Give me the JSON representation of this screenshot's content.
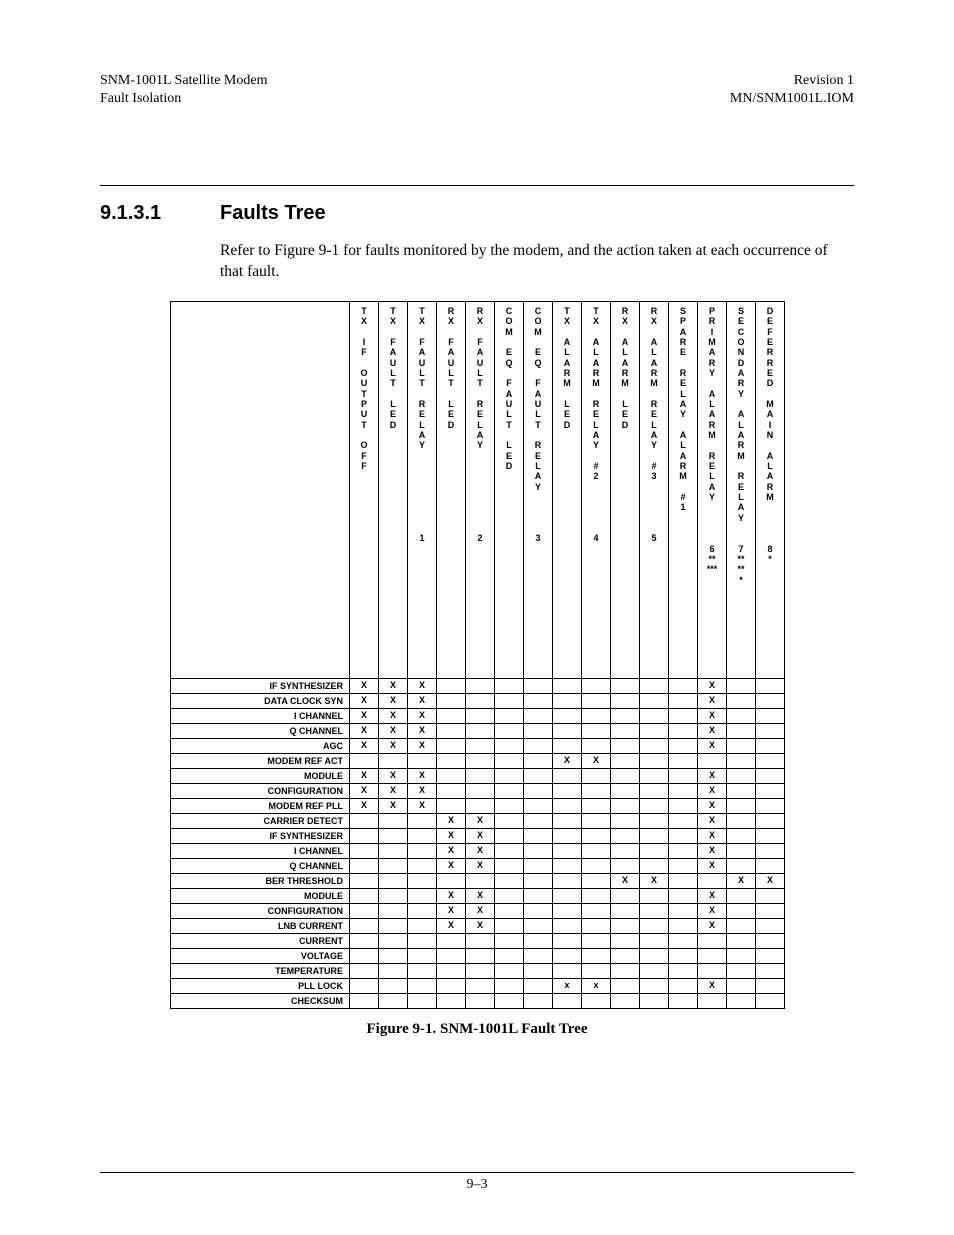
{
  "header": {
    "left1": "SNM-1001L Satellite Modem",
    "left2": "Fault Isolation",
    "right1": "Revision 1",
    "right2": "MN/SNM1001L.IOM"
  },
  "section": {
    "number": "9.1.3.1",
    "title": "Faults Tree",
    "intro": "Refer to Figure 9-1 for faults monitored by the modem, and the action taken at each occurrence of that fault."
  },
  "columns": [
    {
      "lines": [
        "T",
        "X",
        " ",
        "I",
        "F",
        " ",
        "O",
        "U",
        "T",
        "P",
        "U",
        "T",
        " ",
        "O",
        "F",
        "F"
      ]
    },
    {
      "lines": [
        "T",
        "X",
        " ",
        "F",
        "A",
        "U",
        "L",
        "T",
        " ",
        "L",
        "E",
        "D"
      ]
    },
    {
      "lines": [
        "T",
        "X",
        " ",
        "F",
        "A",
        "U",
        "L",
        "T",
        " ",
        "R",
        "E",
        "L",
        "A",
        "Y",
        " ",
        " ",
        " ",
        " ",
        " ",
        " ",
        " ",
        " ",
        "1"
      ]
    },
    {
      "lines": [
        "R",
        "X",
        " ",
        "F",
        "A",
        "U",
        "L",
        "T",
        " ",
        "L",
        "E",
        "D"
      ]
    },
    {
      "lines": [
        "R",
        "X",
        " ",
        "F",
        "A",
        "U",
        "L",
        "T",
        " ",
        "R",
        "E",
        "L",
        "A",
        "Y",
        " ",
        " ",
        " ",
        " ",
        " ",
        " ",
        " ",
        " ",
        "2"
      ]
    },
    {
      "lines": [
        "C",
        "O",
        "M",
        " ",
        "E",
        "Q",
        " ",
        "F",
        "A",
        "U",
        "L",
        "T",
        " ",
        "L",
        "E",
        "D"
      ]
    },
    {
      "lines": [
        "C",
        "O",
        "M",
        " ",
        "E",
        "Q",
        " ",
        "F",
        "A",
        "U",
        "L",
        "T",
        " ",
        "R",
        "E",
        "L",
        "A",
        "Y",
        " ",
        " ",
        " ",
        " ",
        "3"
      ]
    },
    {
      "lines": [
        "T",
        "X",
        " ",
        "A",
        "L",
        "A",
        "R",
        "M",
        " ",
        "L",
        "E",
        "D"
      ]
    },
    {
      "lines": [
        "T",
        "X",
        " ",
        "A",
        "L",
        "A",
        "R",
        "M",
        " ",
        "R",
        "E",
        "L",
        "A",
        "Y",
        " ",
        "#",
        "2",
        " ",
        " ",
        " ",
        " ",
        " ",
        "4"
      ]
    },
    {
      "lines": [
        "R",
        "X",
        " ",
        "A",
        "L",
        "A",
        "R",
        "M",
        " ",
        "L",
        "E",
        "D"
      ]
    },
    {
      "lines": [
        "R",
        "X",
        " ",
        "A",
        "L",
        "A",
        "R",
        "M",
        " ",
        "R",
        "E",
        "L",
        "A",
        "Y",
        " ",
        "#",
        "3",
        " ",
        " ",
        " ",
        " ",
        " ",
        "5"
      ]
    },
    {
      "lines": [
        "S",
        "P",
        "A",
        "R",
        "E",
        " ",
        "R",
        "E",
        "L",
        "A",
        "Y",
        " ",
        "A",
        "L",
        "A",
        "R",
        "M",
        " ",
        "#",
        "1"
      ]
    },
    {
      "lines": [
        "P",
        "R",
        "I",
        "M",
        "A",
        "R",
        "Y",
        " ",
        "A",
        "L",
        "A",
        "R",
        "M",
        " ",
        "R",
        "E",
        "L",
        "A",
        "Y",
        " ",
        " ",
        " ",
        " ",
        "6",
        "**",
        "***"
      ]
    },
    {
      "lines": [
        "S",
        "E",
        "C",
        "O",
        "N",
        "D",
        "A",
        "R",
        "Y",
        " ",
        "A",
        "L",
        "A",
        "R",
        "M",
        " ",
        "R",
        "E",
        "L",
        "A",
        "Y",
        " ",
        " ",
        "7",
        "**",
        "**",
        "*"
      ]
    },
    {
      "lines": [
        "D",
        "E",
        "F",
        "E",
        "R",
        "R",
        "E",
        "D",
        " ",
        "M",
        "A",
        "I",
        "N",
        " ",
        "A",
        "L",
        "A",
        "R",
        "M",
        " ",
        " ",
        " ",
        " ",
        "8",
        "*"
      ]
    }
  ],
  "rows": [
    {
      "label": "IF SYNTHESIZER",
      "cells": [
        "X",
        "X",
        "X",
        "",
        "",
        "",
        "",
        "",
        "",
        "",
        "",
        "",
        "X",
        "",
        ""
      ]
    },
    {
      "label": "DATA CLOCK SYN",
      "cells": [
        "X",
        "X",
        "X",
        "",
        "",
        "",
        "",
        "",
        "",
        "",
        "",
        "",
        "X",
        "",
        ""
      ]
    },
    {
      "label": "I CHANNEL",
      "cells": [
        "X",
        "X",
        "X",
        "",
        "",
        "",
        "",
        "",
        "",
        "",
        "",
        "",
        "X",
        "",
        ""
      ]
    },
    {
      "label": "Q CHANNEL",
      "cells": [
        "X",
        "X",
        "X",
        "",
        "",
        "",
        "",
        "",
        "",
        "",
        "",
        "",
        "X",
        "",
        ""
      ]
    },
    {
      "label": "AGC",
      "cells": [
        "X",
        "X",
        "X",
        "",
        "",
        "",
        "",
        "",
        "",
        "",
        "",
        "",
        "X",
        "",
        ""
      ]
    },
    {
      "label": "MODEM REF ACT",
      "cells": [
        "",
        "",
        "",
        "",
        "",
        "",
        "",
        "X",
        "X",
        "",
        "",
        "",
        "",
        "",
        ""
      ]
    },
    {
      "label": "MODULE",
      "cells": [
        "X",
        "X",
        "X",
        "",
        "",
        "",
        "",
        "",
        "",
        "",
        "",
        "",
        "X",
        "",
        ""
      ]
    },
    {
      "label": "CONFIGURATION",
      "cells": [
        "X",
        "X",
        "X",
        "",
        "",
        "",
        "",
        "",
        "",
        "",
        "",
        "",
        "X",
        "",
        ""
      ]
    },
    {
      "label": "MODEM REF PLL",
      "cells": [
        "X",
        "X",
        "X",
        "",
        "",
        "",
        "",
        "",
        "",
        "",
        "",
        "",
        "X",
        "",
        ""
      ]
    },
    {
      "label": "CARRIER DETECT",
      "cells": [
        "",
        "",
        "",
        "X",
        "X",
        "",
        "",
        "",
        "",
        "",
        "",
        "",
        "X",
        "",
        ""
      ]
    },
    {
      "label": "IF SYNTHESIZER",
      "cells": [
        "",
        "",
        "",
        "X",
        "X",
        "",
        "",
        "",
        "",
        "",
        "",
        "",
        "X",
        "",
        ""
      ]
    },
    {
      "label": "I CHANNEL",
      "cells": [
        "",
        "",
        "",
        "X",
        "X",
        "",
        "",
        "",
        "",
        "",
        "",
        "",
        "X",
        "",
        ""
      ]
    },
    {
      "label": "Q CHANNEL",
      "cells": [
        "",
        "",
        "",
        "X",
        "X",
        "",
        "",
        "",
        "",
        "",
        "",
        "",
        "X",
        "",
        ""
      ]
    },
    {
      "label": "BER THRESHOLD",
      "cells": [
        "",
        "",
        "",
        "",
        "",
        "",
        "",
        "",
        "",
        "X",
        "X",
        "",
        "",
        "X",
        "X"
      ]
    },
    {
      "label": "MODULE",
      "cells": [
        "",
        "",
        "",
        "X",
        "X",
        "",
        "",
        "",
        "",
        "",
        "",
        "",
        "X",
        "",
        ""
      ]
    },
    {
      "label": "CONFIGURATION",
      "cells": [
        "",
        "",
        "",
        "X",
        "X",
        "",
        "",
        "",
        "",
        "",
        "",
        "",
        "X",
        "",
        ""
      ]
    },
    {
      "label": "LNB CURRENT",
      "cells": [
        "",
        "",
        "",
        "X",
        "X",
        "",
        "",
        "",
        "",
        "",
        "",
        "",
        "X",
        "",
        ""
      ]
    },
    {
      "label": "CURRENT",
      "cells": [
        "",
        "",
        "",
        "",
        "",
        "",
        "",
        "",
        "",
        "",
        "",
        "",
        "",
        "",
        ""
      ]
    },
    {
      "label": "VOLTAGE",
      "cells": [
        "",
        "",
        "",
        "",
        "",
        "",
        "",
        "",
        "",
        "",
        "",
        "",
        "",
        "",
        ""
      ]
    },
    {
      "label": "TEMPERATURE",
      "cells": [
        "",
        "",
        "",
        "",
        "",
        "",
        "",
        "",
        "",
        "",
        "",
        "",
        "",
        "",
        ""
      ]
    },
    {
      "label": "PLL LOCK",
      "cells": [
        "",
        "",
        "",
        "",
        "",
        "",
        "",
        "x",
        "x",
        "",
        "",
        "",
        "X",
        "",
        ""
      ]
    },
    {
      "label": "CHECKSUM",
      "cells": [
        "",
        "",
        "",
        "",
        "",
        "",
        "",
        "",
        "",
        "",
        "",
        "",
        "",
        "",
        ""
      ]
    }
  ],
  "figcap": "Figure 9-1.  SNM-1001L  Fault Tree",
  "pagenum": "9–3",
  "chart_data": {
    "type": "table",
    "title": "SNM-1001L Fault Tree",
    "column_headers": [
      "TX IF OUTPUT OFF",
      "TX FAULT LED",
      "TX FAULT RELAY 1",
      "RX FAULT LED",
      "RX FAULT RELAY 2",
      "COM EQ FAULT LED",
      "COM EQ FAULT RELAY 3",
      "TX ALARM LED",
      "TX ALARM RELAY #2 4",
      "RX ALARM LED",
      "RX ALARM RELAY #3 5",
      "SPARE RELAY ALARM #1",
      "PRIMARY ALARM RELAY 6",
      "SECONDARY ALARM RELAY 7",
      "DEFERRED MAIN ALARM 8"
    ],
    "row_labels": [
      "IF SYNTHESIZER",
      "DATA CLOCK SYN",
      "I CHANNEL",
      "Q CHANNEL",
      "AGC",
      "MODEM REF ACT",
      "MODULE",
      "CONFIGURATION",
      "MODEM REF PLL",
      "CARRIER DETECT",
      "IF SYNTHESIZER",
      "I CHANNEL",
      "Q CHANNEL",
      "BER THRESHOLD",
      "MODULE",
      "CONFIGURATION",
      "LNB CURRENT",
      "CURRENT",
      "VOLTAGE",
      "TEMPERATURE",
      "PLL LOCK",
      "CHECKSUM"
    ],
    "matrix": [
      [
        1,
        1,
        1,
        0,
        0,
        0,
        0,
        0,
        0,
        0,
        0,
        0,
        1,
        0,
        0
      ],
      [
        1,
        1,
        1,
        0,
        0,
        0,
        0,
        0,
        0,
        0,
        0,
        0,
        1,
        0,
        0
      ],
      [
        1,
        1,
        1,
        0,
        0,
        0,
        0,
        0,
        0,
        0,
        0,
        0,
        1,
        0,
        0
      ],
      [
        1,
        1,
        1,
        0,
        0,
        0,
        0,
        0,
        0,
        0,
        0,
        0,
        1,
        0,
        0
      ],
      [
        1,
        1,
        1,
        0,
        0,
        0,
        0,
        0,
        0,
        0,
        0,
        0,
        1,
        0,
        0
      ],
      [
        0,
        0,
        0,
        0,
        0,
        0,
        0,
        1,
        1,
        0,
        0,
        0,
        0,
        0,
        0
      ],
      [
        1,
        1,
        1,
        0,
        0,
        0,
        0,
        0,
        0,
        0,
        0,
        0,
        1,
        0,
        0
      ],
      [
        1,
        1,
        1,
        0,
        0,
        0,
        0,
        0,
        0,
        0,
        0,
        0,
        1,
        0,
        0
      ],
      [
        1,
        1,
        1,
        0,
        0,
        0,
        0,
        0,
        0,
        0,
        0,
        0,
        1,
        0,
        0
      ],
      [
        0,
        0,
        0,
        1,
        1,
        0,
        0,
        0,
        0,
        0,
        0,
        0,
        1,
        0,
        0
      ],
      [
        0,
        0,
        0,
        1,
        1,
        0,
        0,
        0,
        0,
        0,
        0,
        0,
        1,
        0,
        0
      ],
      [
        0,
        0,
        0,
        1,
        1,
        0,
        0,
        0,
        0,
        0,
        0,
        0,
        1,
        0,
        0
      ],
      [
        0,
        0,
        0,
        1,
        1,
        0,
        0,
        0,
        0,
        0,
        0,
        0,
        1,
        0,
        0
      ],
      [
        0,
        0,
        0,
        0,
        0,
        0,
        0,
        0,
        0,
        1,
        1,
        0,
        0,
        1,
        1
      ],
      [
        0,
        0,
        0,
        1,
        1,
        0,
        0,
        0,
        0,
        0,
        0,
        0,
        1,
        0,
        0
      ],
      [
        0,
        0,
        0,
        1,
        1,
        0,
        0,
        0,
        0,
        0,
        0,
        0,
        1,
        0,
        0
      ],
      [
        0,
        0,
        0,
        1,
        1,
        0,
        0,
        0,
        0,
        0,
        0,
        0,
        1,
        0,
        0
      ],
      [
        0,
        0,
        0,
        0,
        0,
        0,
        0,
        0,
        0,
        0,
        0,
        0,
        0,
        0,
        0
      ],
      [
        0,
        0,
        0,
        0,
        0,
        0,
        0,
        0,
        0,
        0,
        0,
        0,
        0,
        0,
        0
      ],
      [
        0,
        0,
        0,
        0,
        0,
        0,
        0,
        0,
        0,
        0,
        0,
        0,
        0,
        0,
        0
      ],
      [
        0,
        0,
        0,
        0,
        0,
        0,
        0,
        1,
        1,
        0,
        0,
        0,
        1,
        0,
        0
      ],
      [
        0,
        0,
        0,
        0,
        0,
        0,
        0,
        0,
        0,
        0,
        0,
        0,
        0,
        0,
        0
      ]
    ]
  }
}
